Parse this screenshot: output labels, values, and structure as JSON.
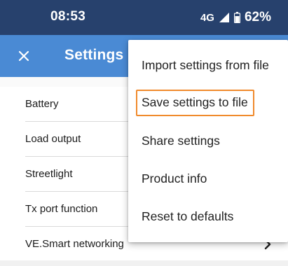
{
  "status_bar": {
    "time": "08:53",
    "network": "4G",
    "battery_percent": "62%",
    "signal_icon": "signal-icon",
    "battery_icon": "battery-icon"
  },
  "app_bar": {
    "close_icon": "close-icon",
    "title": "Settings",
    "color": "#4a8ad4"
  },
  "settings_list": {
    "items": [
      {
        "label": "Battery"
      },
      {
        "label": "Load output"
      },
      {
        "label": "Streetlight"
      },
      {
        "label": "Tx port function"
      },
      {
        "label": "VE.Smart networking",
        "icon": "chevron-right-icon"
      }
    ]
  },
  "overflow_menu": {
    "items": [
      {
        "label": "Import settings from file"
      },
      {
        "label": "Save settings to file",
        "highlighted": true
      },
      {
        "label": "Share settings"
      },
      {
        "label": "Product info"
      },
      {
        "label": "Reset to defaults"
      }
    ],
    "highlight_color": "#f08a2c"
  },
  "colors": {
    "status_bar": "#27416d",
    "app_bar": "#4a8ad4"
  }
}
